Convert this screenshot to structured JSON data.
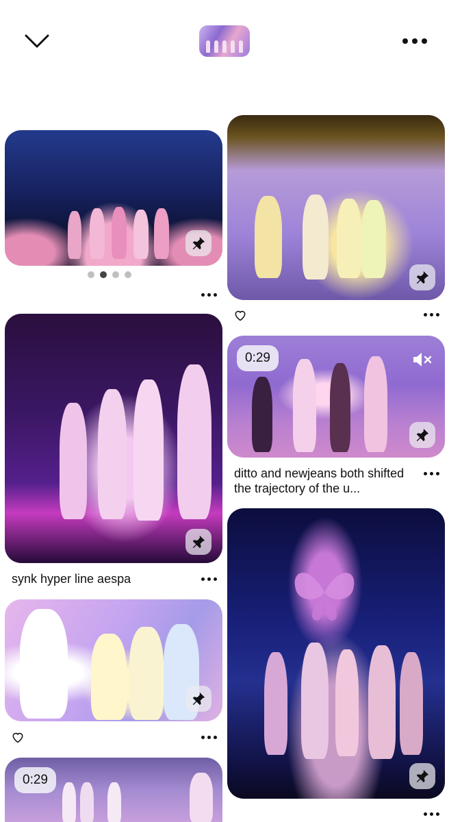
{
  "header": {
    "back_icon": "chevron-down-icon",
    "more_icon": "more-horizontal-icon"
  },
  "pins": [
    {
      "id": "pin-1",
      "carousel_pages": 4,
      "carousel_active": 2
    },
    {
      "id": "pin-2"
    },
    {
      "id": "pin-3",
      "title": "synk hyper line aespa"
    },
    {
      "id": "pin-4",
      "duration": "0:29",
      "title": "ditto and newjeans both shifted the trajectory of the u..."
    },
    {
      "id": "pin-5"
    },
    {
      "id": "pin-6"
    },
    {
      "id": "pin-7",
      "duration": "0:29"
    }
  ],
  "colors": {
    "text": "#111111",
    "badge_bg": "#ebebf0"
  }
}
